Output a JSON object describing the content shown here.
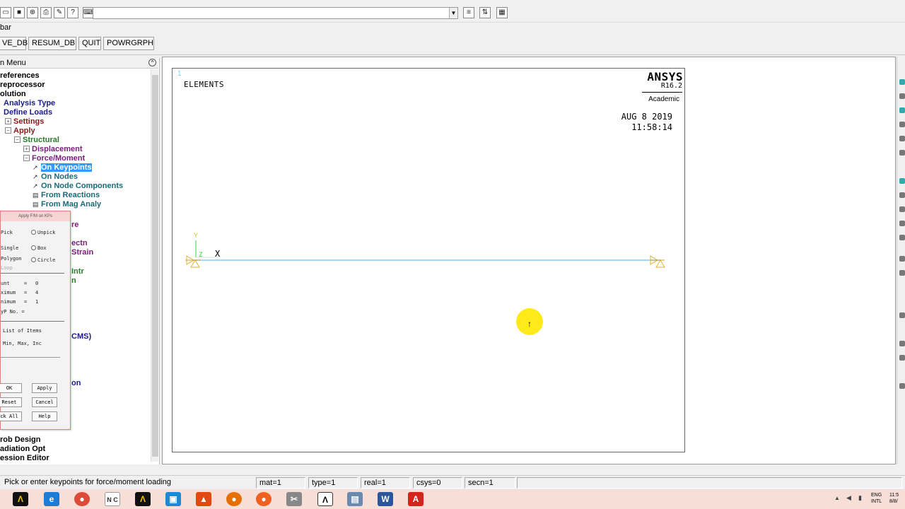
{
  "toolbar": {
    "command_input_value": "",
    "label": "bar"
  },
  "command_buttons": [
    "VE_DB",
    "RESUM_DB",
    "QUIT",
    "POWRGRPH"
  ],
  "main_menu": {
    "title": "n Menu",
    "items": [
      {
        "label": "references",
        "color": "black"
      },
      {
        "label": "reprocessor",
        "color": "black"
      },
      {
        "label": "olution",
        "color": "black"
      },
      {
        "label": "Analysis Type",
        "color": "blue"
      },
      {
        "label": "Define Loads",
        "color": "blue"
      },
      {
        "label": "Settings",
        "color": "red"
      },
      {
        "label": "Apply",
        "color": "red"
      },
      {
        "label": "Structural",
        "color": "green"
      },
      {
        "label": "Displacement",
        "color": "purple"
      },
      {
        "label": "Force/Moment",
        "color": "purple"
      },
      {
        "label": "On Keypoints",
        "color": "selected"
      },
      {
        "label": "On Nodes",
        "color": "teal"
      },
      {
        "label": "On Node Components",
        "color": "teal"
      },
      {
        "label": "From Reactions",
        "color": "teal"
      },
      {
        "label": "From Mag Analy",
        "color": "teal"
      },
      {
        "label": "re",
        "color": "purple"
      },
      {
        "label": "ectn",
        "color": "purple"
      },
      {
        "label": "Strain",
        "color": "purple"
      },
      {
        "label": "Intr",
        "color": "green"
      },
      {
        "label": "n",
        "color": "green"
      },
      {
        "label": "CMS)",
        "color": "blue"
      },
      {
        "label": "on",
        "color": "blue"
      },
      {
        "label": "rob Design",
        "color": "black"
      },
      {
        "label": "adiation Opt",
        "color": "black"
      },
      {
        "label": "ession Editor",
        "color": "black"
      }
    ]
  },
  "pick_dialog": {
    "title": "Apply F/M on KPs",
    "pick": "Pick",
    "unpick": "Unpick",
    "single": "Single",
    "box": "Box",
    "polygon": "Polygon",
    "circle": "Circle",
    "loop": "Loop",
    "count_label": "unt",
    "count_value": "0",
    "maximum_label": "ximum",
    "maximum_value": "4",
    "minimum_label": "nimum",
    "minimum_value": "1",
    "kp_label": "yP No. =",
    "list_of_items": "List of Items",
    "min_max_inc": "Min, Max, Inc",
    "ok": "OK",
    "apply": "Apply",
    "reset": "Reset",
    "cancel": "Cancel",
    "pick_all": "ck All",
    "help": "Help"
  },
  "graphics": {
    "window_number": "1",
    "label": "ELEMENTS",
    "logo": "ANSYS",
    "version": "R16.2",
    "edition": "Academic",
    "date": "AUG  8 2019",
    "time": "11:58:14",
    "axis_y": "Y",
    "axis_z": "Z",
    "axis_x": "X"
  },
  "status_bar": {
    "prompt": "Pick or enter keypoints for force/moment loading",
    "mat": "mat=1",
    "type": "type=1",
    "real": "real=1",
    "csys": "csys=0",
    "secn": "secn=1"
  },
  "tray": {
    "lang": "ENG",
    "layout": "INTL",
    "time": "11:5",
    "date": "8/8/"
  },
  "colors": {
    "selection": "#3399ff",
    "beam": "#7fd0ff",
    "cursor_highlight": "#ffe800",
    "taskbar": "#f7ded6"
  }
}
